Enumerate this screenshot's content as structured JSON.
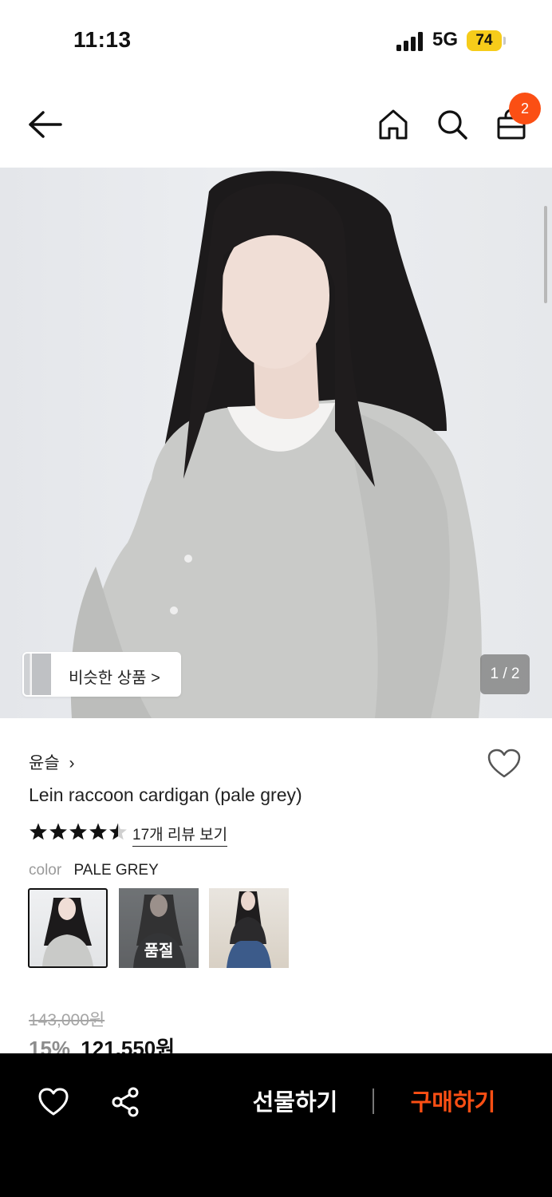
{
  "status_bar": {
    "time": "11:13",
    "network": "5G",
    "battery": "74"
  },
  "nav": {
    "cart_count": "2"
  },
  "image": {
    "similar_label": "비슷한 상품 >",
    "counter": "1 / 2"
  },
  "product": {
    "brand": "윤슬",
    "brand_chevron": "›",
    "title": "Lein raccoon cardigan (pale grey)",
    "rating": 4.5,
    "review_link": "17개 리뷰 보기",
    "color_label": "color",
    "color_value": "PALE GREY",
    "swatches": [
      {
        "selected": true,
        "sold_out": false
      },
      {
        "selected": false,
        "sold_out": true,
        "label": "품절"
      },
      {
        "selected": false,
        "sold_out": false
      }
    ],
    "original_price": "143,000원",
    "discount": "15%",
    "sale_price": "121,550원"
  },
  "bottom_bar": {
    "gift_label": "선물하기",
    "buy_label": "구매하기"
  },
  "colors": {
    "accent": "#fb4f14",
    "battery": "#f6cc1a",
    "bottom_bar": "#000000"
  },
  "icons": [
    "back-arrow-icon",
    "home-icon",
    "search-icon",
    "shopping-bag-icon",
    "heart-icon",
    "share-icon",
    "star-icon"
  ]
}
